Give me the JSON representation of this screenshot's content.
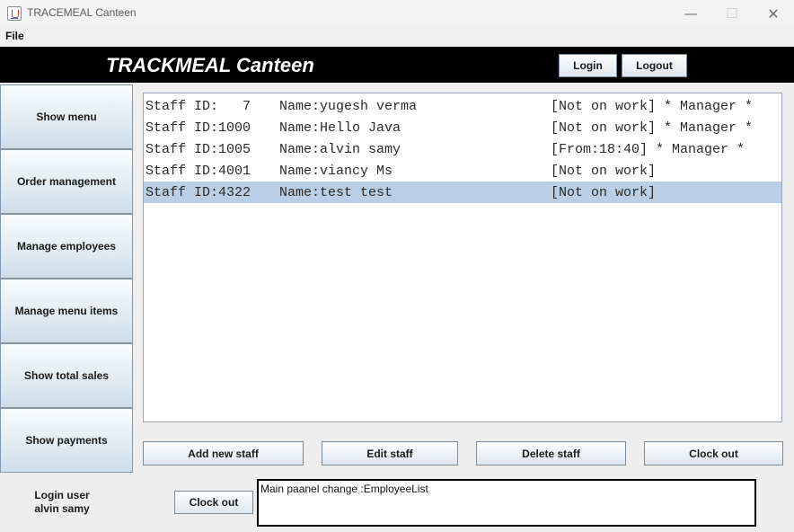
{
  "window": {
    "title": "TRACEMEAL Canteen",
    "controls": {
      "minimize": "—",
      "maximize": "☐",
      "close": "✕"
    }
  },
  "menubar": {
    "file": "File"
  },
  "header": {
    "title": "TRACKMEAL Canteen",
    "login_label": "Login",
    "logout_label": "Logout"
  },
  "sidebar": {
    "items": [
      {
        "label": "Show menu"
      },
      {
        "label": "Order management"
      },
      {
        "label": "Manage employees"
      },
      {
        "label": "Manage menu items"
      },
      {
        "label": "Show total sales"
      },
      {
        "label": "Show payments"
      }
    ]
  },
  "staff_list": {
    "rows": [
      {
        "id": "Staff ID:   7",
        "name": "Name:yugesh verma",
        "status": "[Not on work] * Manager *"
      },
      {
        "id": "Staff ID:1000",
        "name": "Name:Hello Java",
        "status": "[Not on work] * Manager *"
      },
      {
        "id": "Staff ID:1005",
        "name": "Name:alvin samy",
        "status": "[From:18:40] * Manager *"
      },
      {
        "id": "Staff ID:4001",
        "name": "Name:viancy Ms",
        "status": "[Not on work]"
      },
      {
        "id": "Staff ID:4322",
        "name": "Name:test test",
        "status": "[Not on work]",
        "selected": true
      }
    ]
  },
  "actions": {
    "add": "Add new staff",
    "edit": "Edit staff",
    "delete": "Delete staff",
    "clock_out": "Clock out"
  },
  "footer": {
    "login_label": "Login user",
    "login_user": "alvin samy",
    "clock_out": "Clock out",
    "status_message": "Main paanel change :EmployeeList"
  },
  "colors": {
    "header_bg": "#000000",
    "selection": "#b8cfe5",
    "button_gradient_end": "#cfdeea"
  }
}
